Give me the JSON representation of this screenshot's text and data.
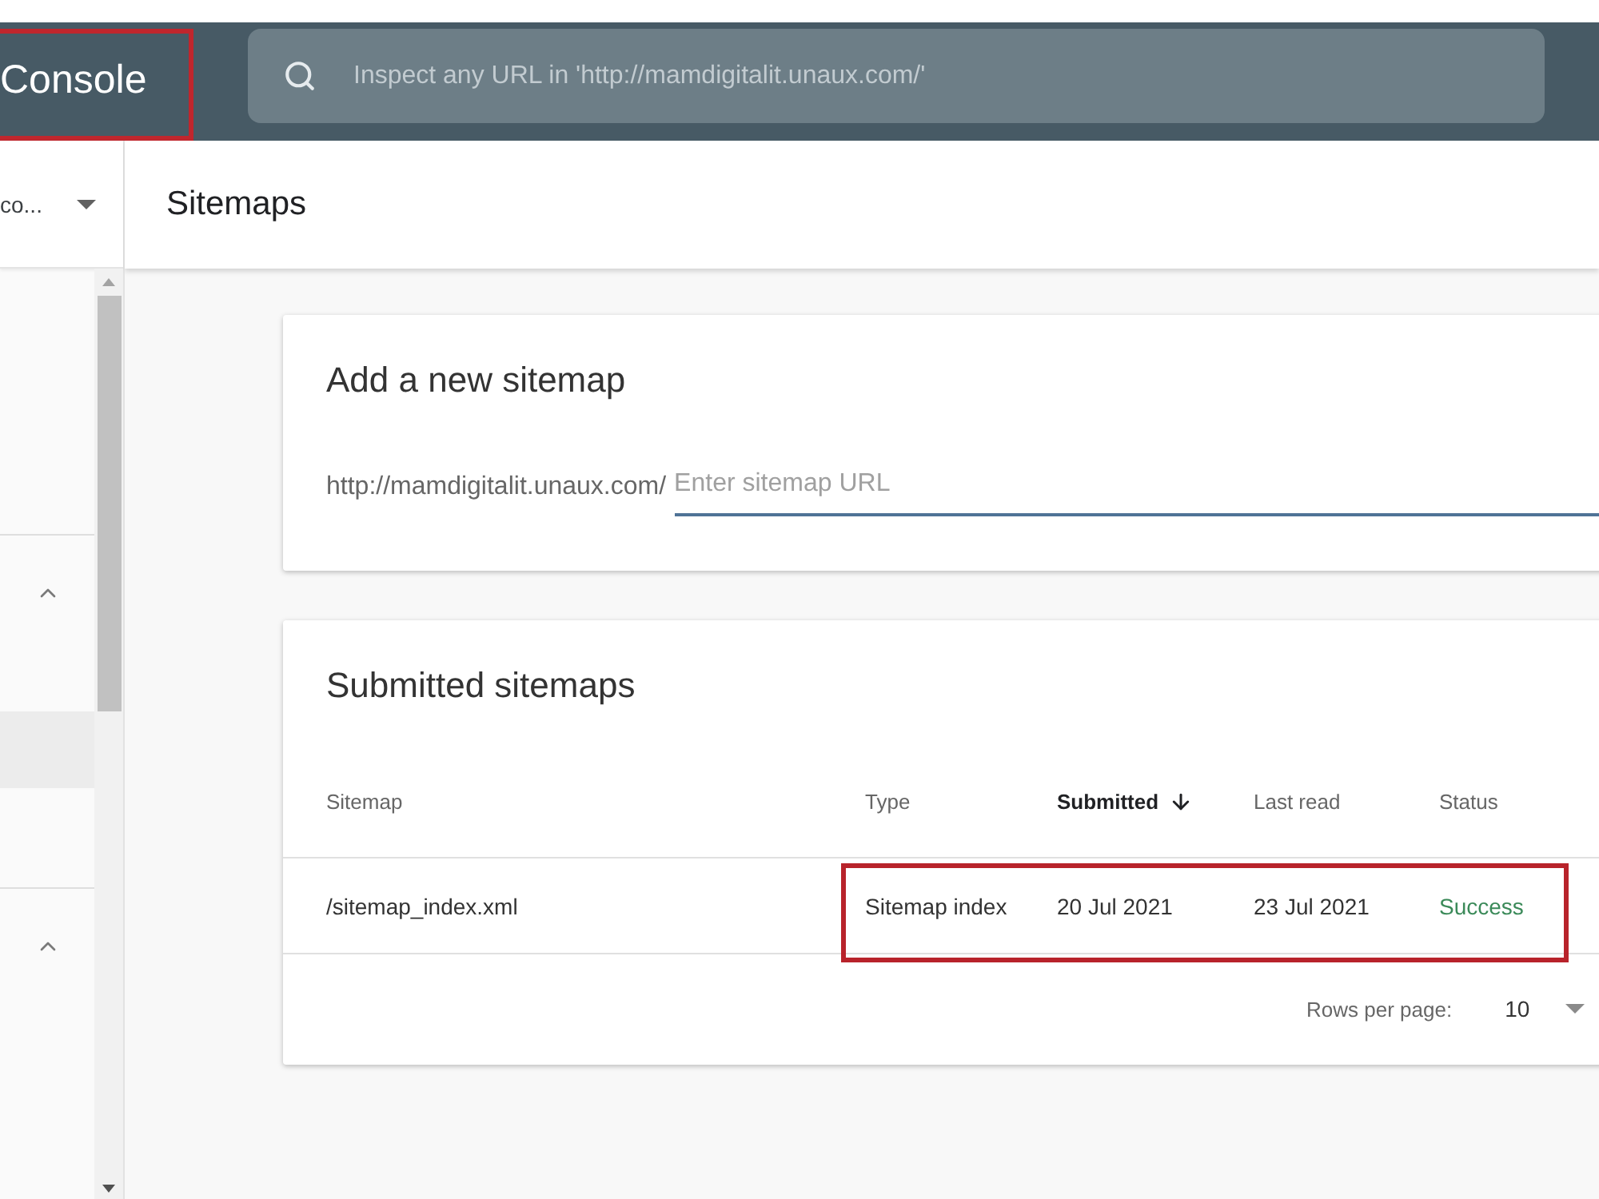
{
  "header": {
    "title": "Console",
    "title_highlighted": true,
    "search": {
      "placeholder": "Inspect any URL in 'http://mamdigitalit.unaux.com/'"
    }
  },
  "sidebar": {
    "property": "co...",
    "groups": [
      {
        "expanded": true,
        "items": [
          {
            "selected": true
          }
        ]
      },
      {
        "expanded": true
      }
    ]
  },
  "page": {
    "title": "Sitemaps"
  },
  "add_sitemap": {
    "title": "Add a new sitemap",
    "prefix": "http://mamdigitalit.unaux.com/",
    "input": {
      "placeholder": "Enter sitemap URL"
    }
  },
  "submitted_sitemaps": {
    "title": "Submitted sitemaps",
    "table": {
      "columns": [
        {
          "label": "Sitemap",
          "sorted": false
        },
        {
          "label": "Type",
          "sorted": false
        },
        {
          "label": "Submitted",
          "sorted": true
        },
        {
          "label": "Last read",
          "sorted": false
        },
        {
          "label": "Status",
          "sorted": false
        }
      ],
      "rows": [
        {
          "cells": [
            {
              "text": "/sitemap_index.xml",
              "kind": "text",
              "highlighted": false
            },
            {
              "text": "Sitemap index",
              "kind": "text",
              "highlighted": true
            },
            {
              "text": "20 Jul 2021",
              "kind": "text",
              "highlighted": true
            },
            {
              "text": "23 Jul 2021",
              "kind": "text",
              "highlighted": true
            },
            {
              "text": "Success",
              "kind": "success",
              "highlighted": true
            }
          ]
        }
      ]
    },
    "pagination": {
      "label": "Rows per page:",
      "value": "10"
    }
  }
}
